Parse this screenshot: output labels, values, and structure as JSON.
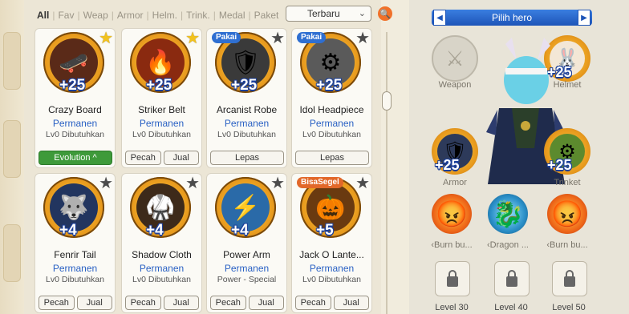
{
  "filters": [
    "All",
    "Fav",
    "Weap",
    "Armor",
    "Helm.",
    "Trink.",
    "Medal",
    "Paket"
  ],
  "sort": {
    "selected": "Terbaru"
  },
  "items": [
    {
      "name": "Crazy Board",
      "permanence": "Permanen",
      "requirement": "Lv0 Dibutuhkan",
      "enhance": "+25",
      "star": "gold",
      "tag": "",
      "icon": "board-icon",
      "glyph": "🛹",
      "buttons": [
        "Evolution ^"
      ]
    },
    {
      "name": "Striker Belt",
      "permanence": "Permanen",
      "requirement": "Lv0 Dibutuhkan",
      "enhance": "+25",
      "star": "gold",
      "tag": "",
      "icon": "belt-icon",
      "glyph": "🔥",
      "buttons": [
        "Pecah",
        "Jual"
      ]
    },
    {
      "name": "Arcanist Robe",
      "permanence": "Permanen",
      "requirement": "Lv0 Dibutuhkan",
      "enhance": "+25",
      "star": "grey",
      "tag": "Pakai",
      "icon": "robe-icon",
      "glyph": "🛡",
      "buttons": [
        "Lepas"
      ]
    },
    {
      "name": "Idol Headpiece",
      "permanence": "Permanen",
      "requirement": "Lv0 Dibutuhkan",
      "enhance": "+25",
      "star": "grey",
      "tag": "Pakai",
      "icon": "headpiece-icon",
      "glyph": "⚙",
      "buttons": [
        "Lepas"
      ]
    },
    {
      "name": "Fenrir Tail",
      "permanence": "Permanen",
      "requirement": "Lv0 Dibutuhkan",
      "enhance": "+4",
      "star": "grey",
      "tag": "",
      "icon": "tail-icon",
      "glyph": "🐺",
      "buttons": [
        "Pecah",
        "Jual"
      ]
    },
    {
      "name": "Shadow Cloth",
      "permanence": "Permanen",
      "requirement": "Lv0 Dibutuhkan",
      "enhance": "+4",
      "star": "grey",
      "tag": "",
      "icon": "cloth-icon",
      "glyph": "🥋",
      "buttons": [
        "Pecah",
        "Jual"
      ]
    },
    {
      "name": "Power Arm",
      "permanence": "Permanen",
      "requirement": "Power - Special",
      "enhance": "+4",
      "star": "grey",
      "tag": "",
      "icon": "arm-icon",
      "glyph": "⚡",
      "buttons": [
        "Pecah",
        "Jual"
      ]
    },
    {
      "name": "Jack O Lante...",
      "permanence": "Permanen",
      "requirement": "Lv0 Dibutuhkan",
      "enhance": "+5",
      "star": "grey",
      "tag": "BisaSegel",
      "icon": "pumpkin-icon",
      "glyph": "🎃",
      "buttons": [
        "Pecah",
        "Jual"
      ]
    }
  ],
  "hero_panel": {
    "title": "Pilih hero",
    "slots": {
      "weapon": {
        "label": "Weapon",
        "enhance": ""
      },
      "helmet": {
        "label": "Helmet",
        "enhance": "+25"
      },
      "armor": {
        "label": "Armor",
        "enhance": "+25"
      },
      "trinket": {
        "label": "Trinket",
        "enhance": "+25"
      }
    },
    "skills": [
      {
        "label": "‹Burn bu...",
        "icon": "fire-skull-icon"
      },
      {
        "label": "‹Dragon ...",
        "icon": "dragon-icon"
      },
      {
        "label": "‹Burn bu...",
        "icon": "fire-skull-icon"
      }
    ],
    "locked": [
      {
        "level": "Level 30"
      },
      {
        "level": "Level 40"
      },
      {
        "level": "Level 50"
      }
    ]
  },
  "colors": {
    "accent": "#2a61c4",
    "gold": "#f2c21e",
    "green": "#3e9a3a",
    "orange": "#e2682a"
  }
}
